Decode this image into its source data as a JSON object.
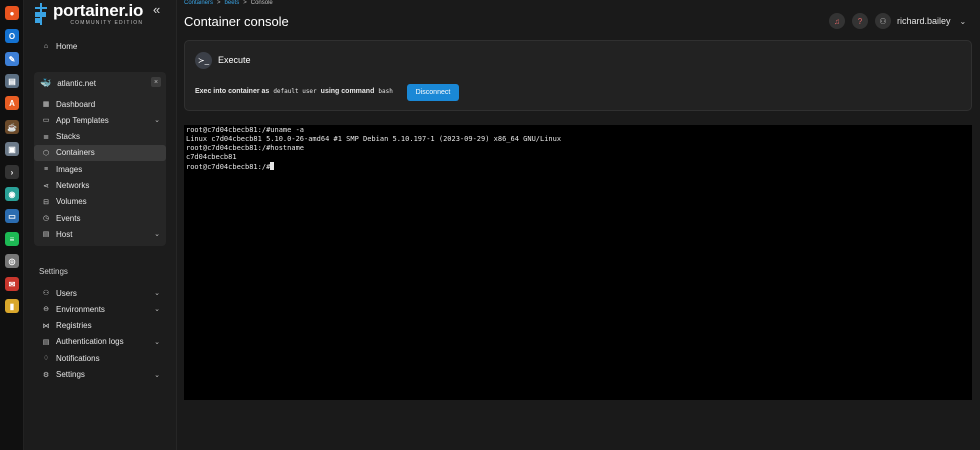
{
  "dock": {
    "apps": [
      {
        "name": "firefox-icon",
        "color": "#e8541f",
        "glyph": "●"
      },
      {
        "name": "outlook-icon",
        "color": "#1472d1",
        "glyph": "O"
      },
      {
        "name": "notes-icon",
        "color": "#3d7fd6",
        "glyph": "✎"
      },
      {
        "name": "files-icon",
        "color": "#5c6f82",
        "glyph": "▤"
      },
      {
        "name": "software-icon",
        "color": "#e85d23",
        "glyph": "A"
      },
      {
        "name": "coffee-icon",
        "color": "#6b4a2a",
        "glyph": "☕"
      },
      {
        "name": "settings-app-icon",
        "color": "#6c7a89",
        "glyph": "▣"
      },
      {
        "name": "terminal-app-icon",
        "color": "#333333",
        "glyph": "›"
      },
      {
        "name": "browser-icon",
        "color": "#2aa198",
        "glyph": "◉"
      },
      {
        "name": "remote-desktop-icon",
        "color": "#2b6cb0",
        "glyph": "▭"
      },
      {
        "name": "spotify-icon",
        "color": "#1db954",
        "glyph": "≡"
      },
      {
        "name": "disk-icon",
        "color": "#777777",
        "glyph": "◎"
      },
      {
        "name": "mail-icon",
        "color": "#c8372d",
        "glyph": "✉"
      },
      {
        "name": "archive-icon",
        "color": "#d9a72b",
        "glyph": "▮"
      }
    ]
  },
  "sidebar": {
    "logo_title": "portainer.io",
    "logo_sub": "COMMUNITY EDITION",
    "collapse_glyph": "«",
    "home": {
      "label": "Home",
      "icon": "⌂"
    },
    "environment": {
      "name": "atlantic.net",
      "close": "×"
    },
    "env_items": [
      {
        "label": "Dashboard",
        "icon": "▦",
        "chev": ""
      },
      {
        "label": "App Templates",
        "icon": "▭",
        "chev": "⌄"
      },
      {
        "label": "Stacks",
        "icon": "≣",
        "chev": ""
      },
      {
        "label": "Containers",
        "icon": "⬡",
        "chev": ""
      },
      {
        "label": "Images",
        "icon": "≡",
        "chev": ""
      },
      {
        "label": "Networks",
        "icon": "⋖",
        "chev": ""
      },
      {
        "label": "Volumes",
        "icon": "⊟",
        "chev": ""
      },
      {
        "label": "Events",
        "icon": "◷",
        "chev": ""
      },
      {
        "label": "Host",
        "icon": "▤",
        "chev": "⌄"
      }
    ],
    "active_item": "Containers",
    "settings_label": "Settings",
    "settings_items": [
      {
        "label": "Users",
        "icon": "⚇",
        "chev": "⌄"
      },
      {
        "label": "Environments",
        "icon": "⊖",
        "chev": "⌄"
      },
      {
        "label": "Registries",
        "icon": "⋈",
        "chev": ""
      },
      {
        "label": "Authentication logs",
        "icon": "▤",
        "chev": "⌄"
      },
      {
        "label": "Notifications",
        "icon": "♢",
        "chev": ""
      },
      {
        "label": "Settings",
        "icon": "⚙",
        "chev": "⌄"
      }
    ]
  },
  "header": {
    "breadcrumb": [
      "Containers",
      ">",
      "beets",
      ">",
      "Console"
    ],
    "title": "Container console",
    "user": "richard.bailey",
    "notif_glyph": "♫",
    "help_glyph": "?",
    "avatar_glyph": "⚇",
    "chev": "⌄"
  },
  "exec": {
    "icon": "≻_",
    "title": "Execute",
    "line_prefix": "Exec into container as",
    "user_code": "default user",
    "line_middle": "using command",
    "command_code": "bash",
    "disconnect_label": "Disconnect"
  },
  "terminal": {
    "lines": [
      "root@c7d04cbecb81:/#uname -a",
      "Linux c7d04cbecb81 5.10.0-26-amd64 #1 SMP Debian 5.10.197-1 (2023-09-29) x86_64 GNU/Linux",
      "root@c7d04cbecb81:/#hostname",
      "c7d04cbecb81",
      "root@c7d04cbecb81:/#"
    ]
  }
}
